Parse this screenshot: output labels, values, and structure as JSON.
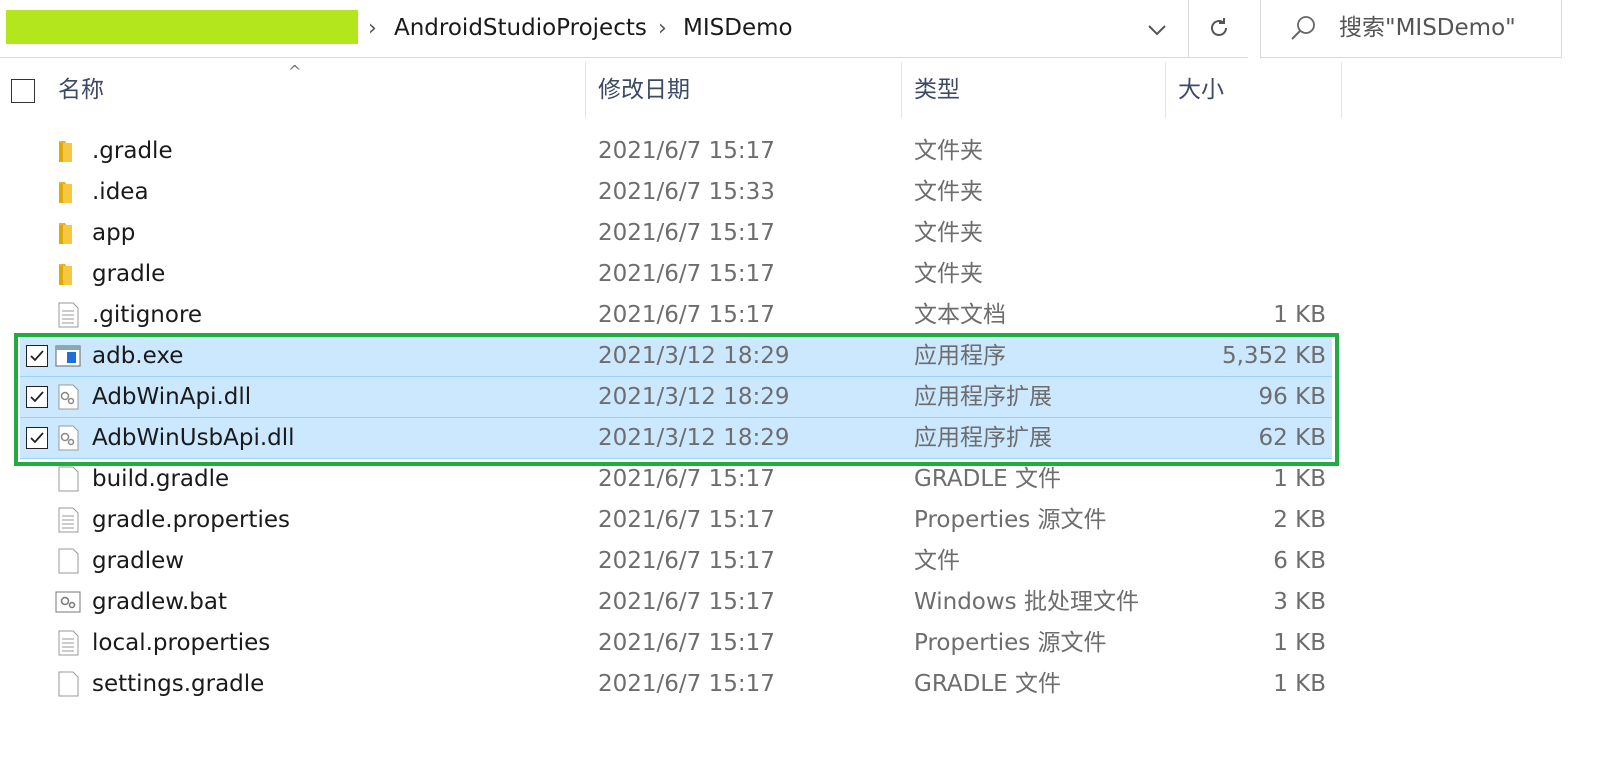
{
  "address": {
    "crumbs": [
      "AndroidStudioProjects",
      "MISDemo"
    ],
    "search_placeholder": "搜索\"MISDemo\""
  },
  "columns": {
    "name": "名称",
    "date": "修改日期",
    "type": "类型",
    "size": "大小"
  },
  "files": [
    {
      "name": ".gradle",
      "date": "2021/6/7 15:17",
      "type": "文件夹",
      "size": "",
      "icon": "folder-icon",
      "selected": false
    },
    {
      "name": ".idea",
      "date": "2021/6/7 15:33",
      "type": "文件夹",
      "size": "",
      "icon": "folder-icon",
      "selected": false
    },
    {
      "name": "app",
      "date": "2021/6/7 15:17",
      "type": "文件夹",
      "size": "",
      "icon": "folder-icon",
      "selected": false
    },
    {
      "name": "gradle",
      "date": "2021/6/7 15:17",
      "type": "文件夹",
      "size": "",
      "icon": "folder-icon",
      "selected": false
    },
    {
      "name": ".gitignore",
      "date": "2021/6/7 15:17",
      "type": "文本文档",
      "size": "1 KB",
      "icon": "text-file-icon",
      "selected": false
    },
    {
      "name": "adb.exe",
      "date": "2021/3/12 18:29",
      "type": "应用程序",
      "size": "5,352 KB",
      "icon": "exe-icon",
      "selected": true
    },
    {
      "name": "AdbWinApi.dll",
      "date": "2021/3/12 18:29",
      "type": "应用程序扩展",
      "size": "96 KB",
      "icon": "dll-icon",
      "selected": true
    },
    {
      "name": "AdbWinUsbApi.dll",
      "date": "2021/3/12 18:29",
      "type": "应用程序扩展",
      "size": "62 KB",
      "icon": "dll-icon",
      "selected": true
    },
    {
      "name": "build.gradle",
      "date": "2021/6/7 15:17",
      "type": "GRADLE 文件",
      "size": "1 KB",
      "icon": "blank-file-icon",
      "selected": false
    },
    {
      "name": "gradle.properties",
      "date": "2021/6/7 15:17",
      "type": "Properties 源文件",
      "size": "2 KB",
      "icon": "text-file-icon",
      "selected": false
    },
    {
      "name": "gradlew",
      "date": "2021/6/7 15:17",
      "type": "文件",
      "size": "6 KB",
      "icon": "blank-file-icon",
      "selected": false
    },
    {
      "name": "gradlew.bat",
      "date": "2021/6/7 15:17",
      "type": "Windows 批处理文件",
      "size": "3 KB",
      "icon": "bat-icon",
      "selected": false
    },
    {
      "name": "local.properties",
      "date": "2021/6/7 15:17",
      "type": "Properties 源文件",
      "size": "1 KB",
      "icon": "text-file-icon",
      "selected": false
    },
    {
      "name": "settings.gradle",
      "date": "2021/6/7 15:17",
      "type": "GRADLE 文件",
      "size": "1 KB",
      "icon": "blank-file-icon",
      "selected": false
    }
  ],
  "colors": {
    "selection": "#cce8ff",
    "highlight": "#22aa44",
    "redaction": "#b3e61c"
  }
}
